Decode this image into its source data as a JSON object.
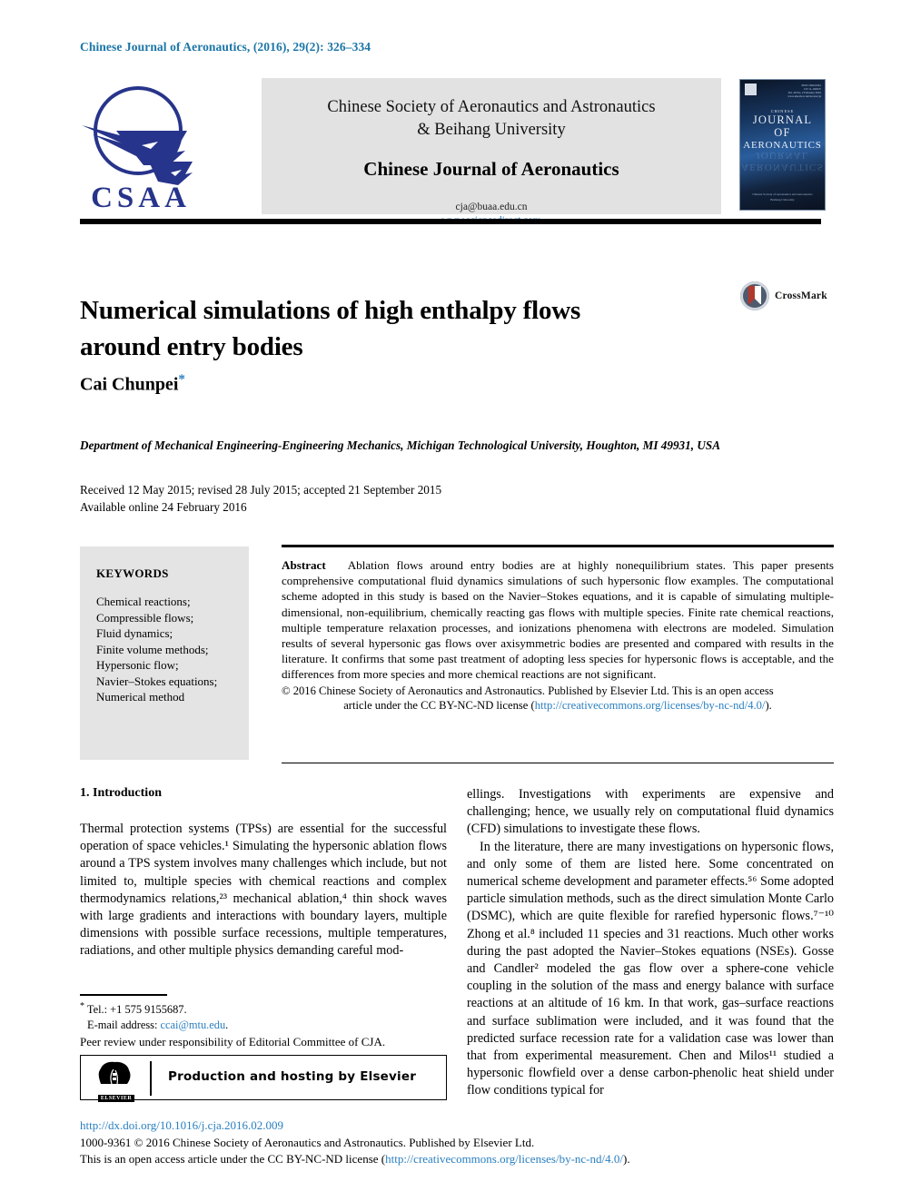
{
  "running_head": "Chinese Journal of Aeronautics, (2016), 29(2): 326–334",
  "masthead": {
    "logo_text": "CSAA",
    "society_line1": "Chinese Society of Aeronautics and Astronautics",
    "society_line2": "& Beihang University",
    "journal_name": "Chinese Journal of Aeronautics",
    "email": "cja@buaa.edu.cn",
    "website": "www.sciencedirect.com",
    "cover": {
      "issn_line": "ISSN 1000-9361\nCN 11-1929/V\nVol. 29 No. 2 February 2016\nwww.elsevier.com/locate/cja",
      "chinese_label": "CHINESE",
      "title_line1": "JOURNAL",
      "title_line2": "OF",
      "title_line3": "AERONAUTICS",
      "footer_line1": "Chinese Society of Aeronautics and Astronautics",
      "footer_line2": "Beihang University"
    }
  },
  "article": {
    "title": "Numerical simulations of high enthalpy flows around entry bodies",
    "crossmark_label": "CrossMark",
    "author": "Cai Chunpei",
    "author_marker": "*",
    "affiliation": "Department of Mechanical Engineering-Engineering Mechanics, Michigan Technological University, Houghton, MI 49931, USA",
    "received_line": "Received 12 May 2015; revised 28 July 2015; accepted 21 September 2015",
    "available_line": "Available online 24 February 2016"
  },
  "keywords": {
    "heading": "KEYWORDS",
    "items": [
      "Chemical reactions;",
      "Compressible flows;",
      "Fluid dynamics;",
      "Finite volume methods;",
      "Hypersonic flow;",
      "Navier–Stokes equations;",
      "Numerical method"
    ]
  },
  "abstract": {
    "label": "Abstract",
    "body": "Ablation flows around entry bodies are at highly nonequilibrium states. This paper presents comprehensive computational fluid dynamics simulations of such hypersonic flow examples. The computational scheme adopted in this study is based on the Navier–Stokes equations, and it is capable of simulating multiple-dimensional, non-equilibrium, chemically reacting gas flows with multiple species. Finite rate chemical reactions, multiple temperature relaxation processes, and ionizations phenomena with electrons are modeled. Simulation results of several hypersonic gas flows over axisymmetric bodies are presented and compared with results in the literature. It confirms that some past treatment of adopting less species for hypersonic flows is acceptable, and the differences from more species and more chemical reactions are not significant.",
    "copyright_line1": "© 2016 Chinese Society of Aeronautics and Astronautics. Published by Elsevier Ltd. This is an open access",
    "copyright_line2_pre": "article under the CC BY-NC-ND license (",
    "copyright_link": "http://creativecommons.org/licenses/by-nc-nd/4.0/",
    "copyright_line2_post": ")."
  },
  "body": {
    "section_heading": "1. Introduction",
    "left_paragraph": "Thermal protection systems (TPSs) are essential for the successful operation of space vehicles.¹ Simulating the hypersonic ablation flows around a TPS system involves many challenges which include, but not limited to, multiple species with chemical reactions and complex thermodynamics relations,²³ mechanical ablation,⁴ thin shock waves with large gradients and interactions with boundary layers, multiple dimensions with possible surface recessions, multiple temperatures, radiations, and other multiple physics demanding careful mod-",
    "right_paragraph_1": "ellings. Investigations with experiments are expensive and challenging; hence, we usually rely on computational fluid dynamics (CFD) simulations to investigate these flows.",
    "right_paragraph_2": "In the literature, there are many investigations on hypersonic flows, and only some of them are listed here. Some concentrated on numerical scheme development and parameter effects.⁵⁶ Some adopted particle simulation methods, such as the direct simulation Monte Carlo (DSMC), which are quite flexible for rarefied hypersonic flows.⁷⁻¹⁰ Zhong et al.⁸ included 11 species and 31 reactions. Much other works during the past adopted the Navier–Stokes equations (NSEs). Gosse and Candler² modeled the gas flow over a sphere-cone vehicle coupling in the solution of the mass and energy balance with surface reactions at an altitude of 16 km. In that work, gas–surface reactions and surface sublimation were included, and it was found that the predicted surface recession rate for a validation case was lower than that from experimental measurement. Chen and Milos¹¹ studied a hypersonic flowfield over a dense carbon-phenolic heat shield under flow conditions typical for"
  },
  "footnote": {
    "tel": "Tel.: +1 575 9155687.",
    "email_label": "E-mail address:",
    "email": "ccai@mtu.edu",
    "email_suffix": ".",
    "peer_review": "Peer review under responsibility of Editorial Committee of CJA.",
    "elsevier_banner": "Production and hosting by Elsevier",
    "elsevier_logo_word": "ELSEVIER"
  },
  "page_footer": {
    "doi": "http://dx.doi.org/10.1016/j.cja.2016.02.009",
    "issn_line": "1000-9361 © 2016 Chinese Society of Aeronautics and Astronautics. Published by Elsevier Ltd.",
    "license_pre": "This is an open access article under the CC BY-NC-ND license (",
    "license_link": "http://creativecommons.org/licenses/by-nc-nd/4.0/",
    "license_post": ")."
  },
  "colors": {
    "link_blue": "#2a7fc0",
    "running_head_blue": "#1b75a8",
    "logo_navy": "#27348b",
    "keyword_bg": "#e4e4e4",
    "banner_bg": "#e2e2e2"
  }
}
